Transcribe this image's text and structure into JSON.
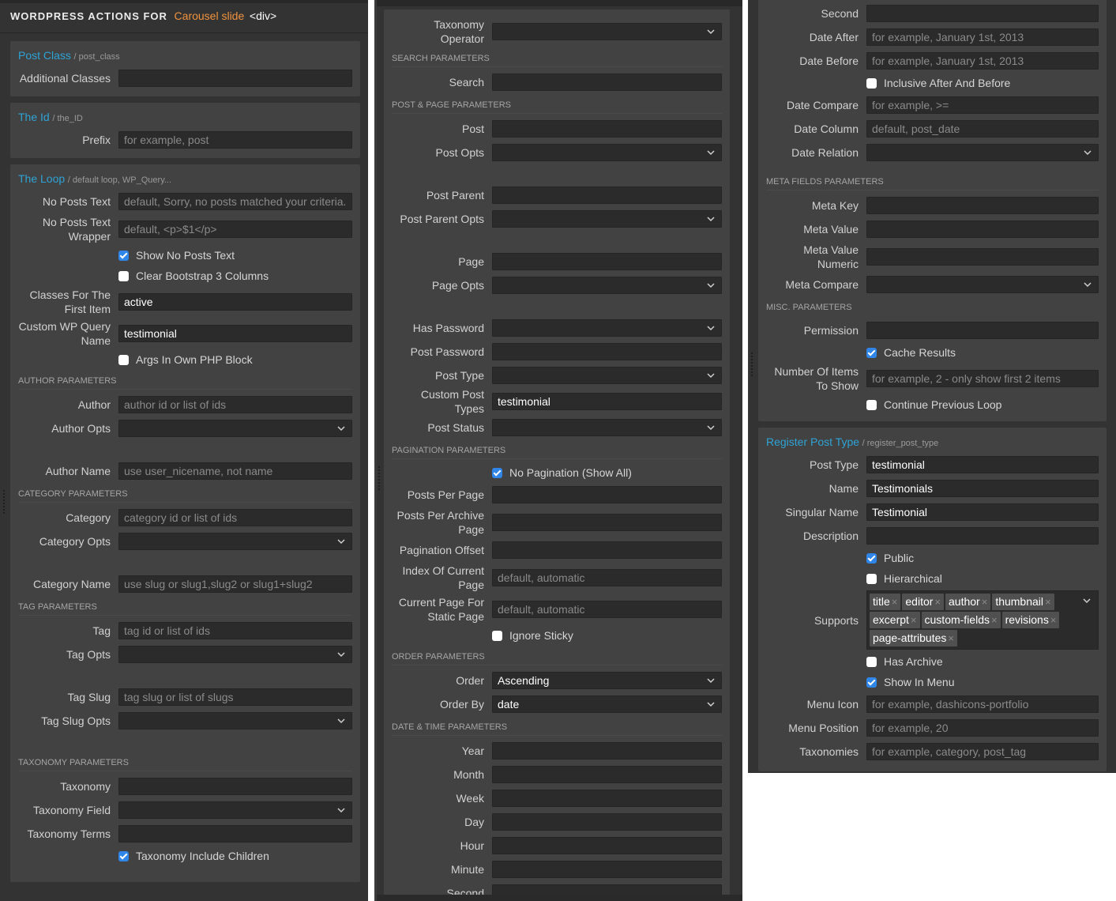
{
  "header": {
    "prefix": "WORDPRESS ACTIONS FOR",
    "element_name": "Carousel slide",
    "element_tag": "<div>"
  },
  "colors": {
    "accent_blue": "#2ea3d5",
    "accent_orange": "#f0923e",
    "checkbox_on": "#2f86e8",
    "panel_bg": "#333333",
    "card_bg": "#424242",
    "field_bg": "#2b2b2b"
  },
  "post_class": {
    "title": "Post Class",
    "sub": "/ post_class",
    "additional_classes": {
      "label": "Additional Classes",
      "value": "",
      "placeholder": ""
    }
  },
  "the_id": {
    "title": "The Id",
    "sub": "/ the_ID",
    "prefix": {
      "label": "Prefix",
      "value": "",
      "placeholder": "for example, post"
    }
  },
  "the_loop": {
    "title": "The Loop",
    "sub": "/ default loop, WP_Query...",
    "no_posts_text": {
      "label": "No Posts Text",
      "placeholder": "default, Sorry, no posts matched your criteria."
    },
    "no_posts_wrapper": {
      "label": "No Posts Text Wrapper",
      "placeholder": "default, <p>$1</p>"
    },
    "show_no_posts": {
      "label": "Show No Posts Text",
      "checked": true
    },
    "clear_bootstrap": {
      "label": "Clear Bootstrap 3 Columns",
      "checked": false
    },
    "classes_first": {
      "label": "Classes For The First Item",
      "value": "active"
    },
    "custom_query_name": {
      "label": "Custom WP Query Name",
      "value": "testimonial"
    },
    "args_own_php": {
      "label": "Args In Own PHP Block",
      "checked": false
    },
    "sections": {
      "author": "AUTHOR PARAMETERS",
      "category": "CATEGORY PARAMETERS",
      "tag": "TAG PARAMETERS",
      "taxonomy": "TAXONOMY PARAMETERS",
      "search": "SEARCH PARAMETERS",
      "post_page": "POST & PAGE PARAMETERS",
      "pagination": "PAGINATION PARAMETERS",
      "order": "ORDER PARAMETERS",
      "datetime": "DATE & TIME PARAMETERS",
      "meta": "META FIELDS PARAMETERS",
      "misc": "MISC. PARAMETERS"
    },
    "author": {
      "label": "Author",
      "placeholder": "author id or list of ids"
    },
    "author_opts": {
      "label": "Author Opts",
      "value": ""
    },
    "author_name": {
      "label": "Author Name",
      "placeholder": "use user_nicename, not name"
    },
    "category": {
      "label": "Category",
      "placeholder": "category id or list of ids"
    },
    "category_opts": {
      "label": "Category Opts",
      "value": ""
    },
    "category_name": {
      "label": "Category Name",
      "placeholder": "use slug or slug1,slug2 or slug1+slug2"
    },
    "tag": {
      "label": "Tag",
      "placeholder": "tag id or list of ids"
    },
    "tag_opts": {
      "label": "Tag Opts",
      "value": ""
    },
    "tag_slug": {
      "label": "Tag Slug",
      "placeholder": "tag slug or list of slugs"
    },
    "tag_slug_opts": {
      "label": "Tag Slug Opts",
      "value": ""
    },
    "taxonomy": {
      "label": "Taxonomy",
      "value": ""
    },
    "taxonomy_field": {
      "label": "Taxonomy Field",
      "value": ""
    },
    "taxonomy_terms": {
      "label": "Taxonomy Terms",
      "value": ""
    },
    "taxonomy_children": {
      "label": "Taxonomy Include Children",
      "checked": true
    },
    "taxonomy_operator": {
      "label": "Taxonomy Operator",
      "value": ""
    },
    "search": {
      "label": "Search",
      "value": ""
    },
    "post": {
      "label": "Post",
      "value": ""
    },
    "post_opts": {
      "label": "Post Opts",
      "value": ""
    },
    "post_parent": {
      "label": "Post Parent",
      "value": ""
    },
    "post_parent_opts": {
      "label": "Post Parent Opts",
      "value": ""
    },
    "page": {
      "label": "Page",
      "value": ""
    },
    "page_opts": {
      "label": "Page Opts",
      "value": ""
    },
    "has_password": {
      "label": "Has Password",
      "value": ""
    },
    "post_password": {
      "label": "Post Password",
      "value": ""
    },
    "post_type": {
      "label": "Post Type",
      "value": ""
    },
    "custom_post_types": {
      "label": "Custom Post Types",
      "value": "testimonial"
    },
    "post_status": {
      "label": "Post Status",
      "value": ""
    },
    "no_pagination": {
      "label": "No Pagination (Show All)",
      "checked": true
    },
    "posts_per_page": {
      "label": "Posts Per Page",
      "value": ""
    },
    "posts_per_archive": {
      "label": "Posts Per Archive Page",
      "value": ""
    },
    "pagination_offset": {
      "label": "Pagination Offset",
      "value": ""
    },
    "index_current_page": {
      "label": "Index Of Current Page",
      "placeholder": "default, automatic"
    },
    "current_page_static": {
      "label": "Current Page For Static Page",
      "placeholder": "default, automatic"
    },
    "ignore_sticky": {
      "label": "Ignore Sticky",
      "checked": false
    },
    "order": {
      "label": "Order",
      "value": "Ascending"
    },
    "order_by": {
      "label": "Order By",
      "value": "date"
    },
    "year": {
      "label": "Year",
      "value": ""
    },
    "month": {
      "label": "Month",
      "value": ""
    },
    "week": {
      "label": "Week",
      "value": ""
    },
    "day": {
      "label": "Day",
      "value": ""
    },
    "hour": {
      "label": "Hour",
      "value": ""
    },
    "minute": {
      "label": "Minute",
      "value": ""
    },
    "second": {
      "label": "Second",
      "value": ""
    },
    "date_after": {
      "label": "Date After",
      "placeholder": "for example, January 1st, 2013"
    },
    "date_before": {
      "label": "Date Before",
      "placeholder": "for example, January 1st, 2013"
    },
    "inclusive": {
      "label": "Inclusive After And Before",
      "checked": false
    },
    "date_compare": {
      "label": "Date Compare",
      "placeholder": "for example, >="
    },
    "date_column": {
      "label": "Date Column",
      "placeholder": "default, post_date"
    },
    "date_relation": {
      "label": "Date Relation",
      "value": ""
    },
    "meta_key": {
      "label": "Meta Key",
      "value": ""
    },
    "meta_value": {
      "label": "Meta Value",
      "value": ""
    },
    "meta_value_numeric": {
      "label": "Meta Value Numeric",
      "value": ""
    },
    "meta_compare": {
      "label": "Meta Compare",
      "value": ""
    },
    "permission": {
      "label": "Permission",
      "value": ""
    },
    "cache_results": {
      "label": "Cache Results",
      "checked": true
    },
    "num_items": {
      "label": "Number Of Items To Show",
      "placeholder": "for example, 2 - only show first 2 items"
    },
    "continue_loop": {
      "label": "Continue Previous Loop",
      "checked": false
    }
  },
  "register_post_type": {
    "title": "Register Post Type",
    "sub": "/ register_post_type",
    "post_type": {
      "label": "Post Type",
      "value": "testimonial"
    },
    "name": {
      "label": "Name",
      "value": "Testimonials"
    },
    "singular_name": {
      "label": "Singular Name",
      "value": "Testimonial"
    },
    "description": {
      "label": "Description",
      "value": ""
    },
    "public": {
      "label": "Public",
      "checked": true
    },
    "hierarchical": {
      "label": "Hierarchical",
      "checked": false
    },
    "supports": {
      "label": "Supports",
      "tags": [
        "title",
        "editor",
        "author",
        "thumbnail",
        "excerpt",
        "custom-fields",
        "revisions",
        "page-attributes"
      ]
    },
    "has_archive": {
      "label": "Has Archive",
      "checked": false
    },
    "show_in_menu": {
      "label": "Show In Menu",
      "checked": true
    },
    "menu_icon": {
      "label": "Menu Icon",
      "placeholder": "for example, dashicons-portfolio"
    },
    "menu_position": {
      "label": "Menu Position",
      "placeholder": "for example, 20"
    },
    "taxonomies": {
      "label": "Taxonomies",
      "placeholder": "for example, category, post_tag"
    }
  }
}
